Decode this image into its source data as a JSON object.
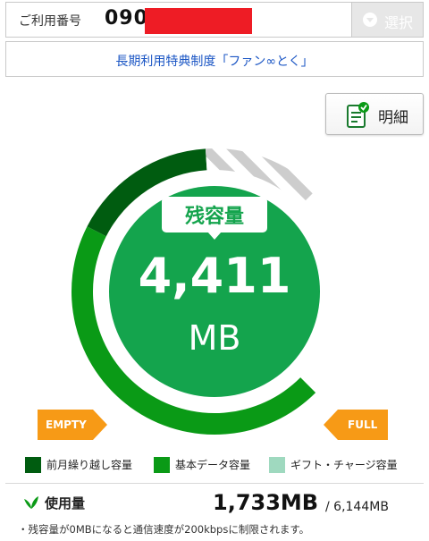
{
  "line": {
    "label": "ご利用番号",
    "number": "090",
    "select_label": "選択"
  },
  "link": {
    "text": "長期利用特典制度「ファン∞とく」"
  },
  "detail": {
    "label": "明細"
  },
  "gauge": {
    "bubble_label": "残容量",
    "remaining_value": "4,411",
    "remaining_unit": "MB",
    "empty_label": "EMPTY",
    "full_label": "FULL",
    "carryover_fraction": 0.22,
    "basic_fraction": 0.6,
    "gift_fraction": 0.18
  },
  "legend": {
    "items": [
      {
        "label": "前月繰り越し容量",
        "color": "#005c10"
      },
      {
        "label": "基本データ容量",
        "color": "#0a9a16"
      },
      {
        "label": "ギフト・チャージ容量",
        "color": "#9fd9bf"
      }
    ]
  },
  "usage": {
    "label": "使用量",
    "value": "1,733MB",
    "total": "/ 6,144MB"
  },
  "note": "・残容量が0MBになると通信速度が200kbpsに制限されます。",
  "colors": {
    "carryover": "#005c10",
    "basic": "#0a9a16",
    "center": "#14a44d",
    "gift_stripe": "#cdcdcd",
    "tag": "#f79a16",
    "link": "#1a55c4",
    "redaction": "#ee1c25"
  }
}
